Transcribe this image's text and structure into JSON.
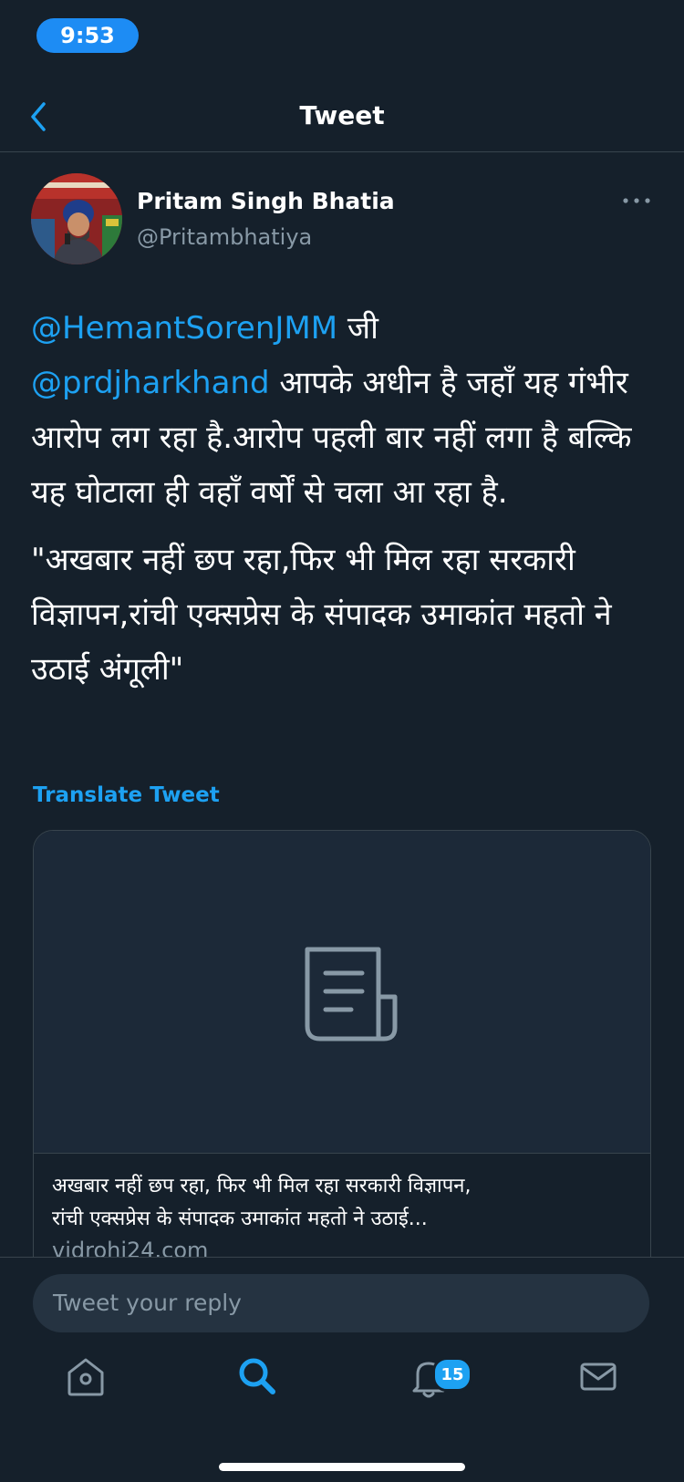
{
  "status_bar": {
    "time": "9:53"
  },
  "nav": {
    "title": "Tweet"
  },
  "tweet": {
    "author_name": "Pritam Singh Bhatia",
    "author_handle": "@Pritambhatiya",
    "line1_mention": "@HemantSorenJMM",
    "line1_text": " जी",
    "line2_mention": "@prdjharkhand",
    "line2_text": " आपके अधीन है जहाँ यह गंभीर आरोप लग रहा है.आरोप पहली बार नहीं लगा है बल्कि यह घोटाला ही वहाँ वर्षों से चला आ रहा है.",
    "paragraph2": "\"अखबार नहीं छप रहा,फिर भी मिल रहा सरकारी विज्ञापन,रांची एक्सप्रेस के संपादक उमाकांत महतो ने उठाई अंगूली\"",
    "translate_label": "Translate Tweet"
  },
  "link_card": {
    "title_line1": "अखबार नहीं छप रहा, फिर भी मिल रहा सरकारी विज्ञापन,",
    "title_line2": "रांची एक्सप्रेस के संपादक उमाकांत महतो ने उठाई...",
    "domain": "vidrohi24.com",
    "icon": "document-icon"
  },
  "reply": {
    "placeholder": "Tweet your reply"
  },
  "tab_bar": {
    "items": [
      {
        "icon": "home-icon",
        "active": false
      },
      {
        "icon": "search-icon",
        "active": true
      },
      {
        "icon": "notifications-icon",
        "active": false,
        "badge": "15"
      },
      {
        "icon": "messages-icon",
        "active": false
      }
    ]
  },
  "colors": {
    "background": "#15202b",
    "accent": "#1da1f2",
    "secondary_text": "#8899a6",
    "border": "#38444d"
  }
}
